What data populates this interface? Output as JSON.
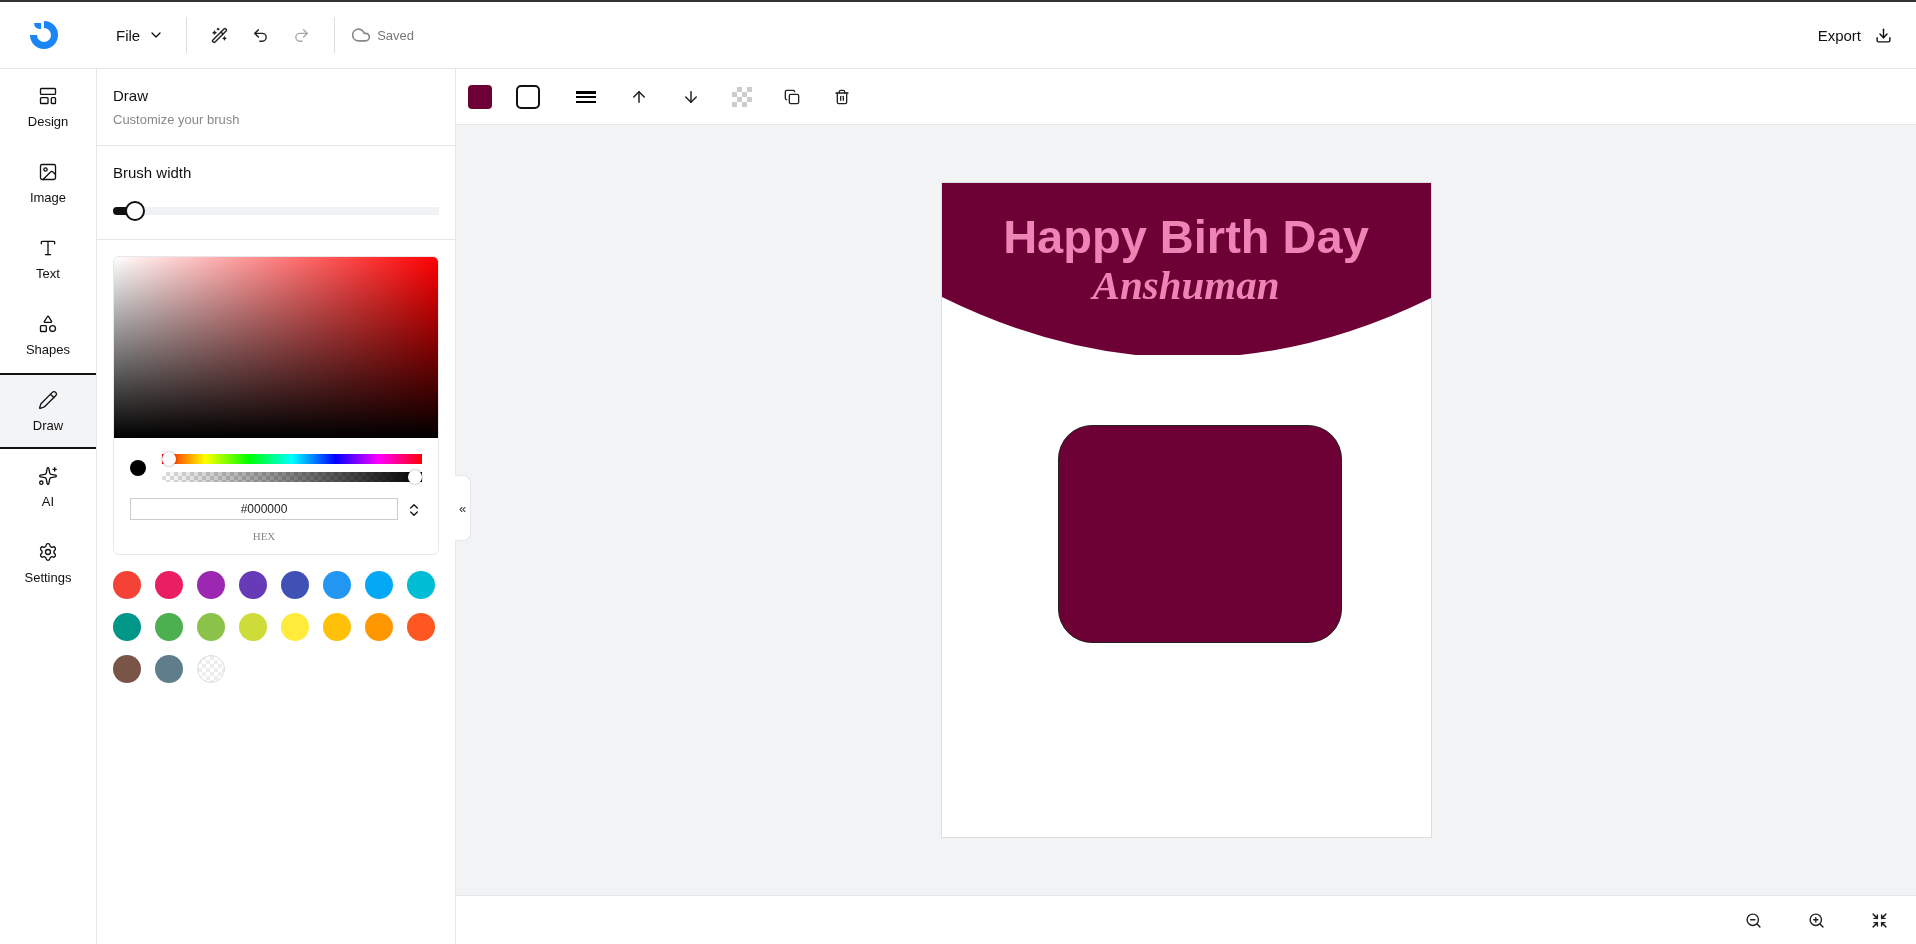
{
  "topbar": {
    "menu": "File",
    "actions": [
      {
        "kind": "magic",
        "disabled": false
      },
      {
        "kind": "undo",
        "disabled": false
      },
      {
        "kind": "redo",
        "disabled": true
      }
    ],
    "status": "Saved",
    "export": "Export"
  },
  "sidebar": {
    "items": [
      {
        "label": "Design",
        "selected": false
      },
      {
        "label": "Image",
        "selected": false
      },
      {
        "label": "Text",
        "selected": false
      },
      {
        "label": "Shapes",
        "selected": false
      },
      {
        "label": "Draw",
        "selected": true
      },
      {
        "label": "AI",
        "selected": false
      },
      {
        "label": "Settings",
        "selected": false
      }
    ]
  },
  "panel": {
    "title": "Draw",
    "subtitle": "Customize your brush",
    "brush_label": "Brush width",
    "brush": {
      "level": 0.04
    },
    "picker": {
      "hue": {
        "level": 0
      },
      "alpha": {
        "level": 1
      },
      "hex": "#000000",
      "mode": "HEX"
    },
    "swatches": [
      {
        "kind": "color",
        "color": "#f44336"
      },
      {
        "kind": "color",
        "color": "#e91e63"
      },
      {
        "kind": "color",
        "color": "#9c27b0"
      },
      {
        "kind": "color",
        "color": "#673ab7"
      },
      {
        "kind": "color",
        "color": "#3f51b5"
      },
      {
        "kind": "color",
        "color": "#2196f3"
      },
      {
        "kind": "color",
        "color": "#03a9f4"
      },
      {
        "kind": "color",
        "color": "#00bcd4"
      },
      {
        "kind": "color",
        "color": "#009688"
      },
      {
        "kind": "color",
        "color": "#4caf50"
      },
      {
        "kind": "color",
        "color": "#8bc34a"
      },
      {
        "kind": "color",
        "color": "#cddc39"
      },
      {
        "kind": "color",
        "color": "#ffeb3b"
      },
      {
        "kind": "color",
        "color": "#ffc107"
      },
      {
        "kind": "color",
        "color": "#ff9800"
      },
      {
        "kind": "color",
        "color": "#ff5722"
      },
      {
        "kind": "color",
        "color": "#795548"
      },
      {
        "kind": "color",
        "color": "#607d8b"
      },
      {
        "kind": "transparent"
      }
    ]
  },
  "collapse": "«",
  "toolbar": {
    "fill": {
      "color": "#6d0035"
    }
  },
  "design": {
    "title": "Happy Birth Day",
    "name": "Anshuman"
  }
}
